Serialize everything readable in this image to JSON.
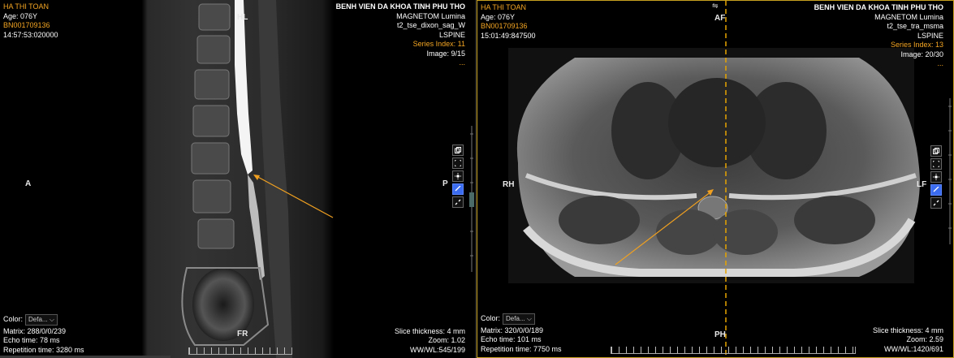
{
  "left_viewport": {
    "patient_name": "HA THI TOAN",
    "age": "Age: 076Y",
    "patient_id": "BN001709136",
    "time": "14:57:53:020000",
    "hospital": "BENH VIEN DA KHOA TINH PHU THO",
    "scanner": "MAGNETOM Lumina",
    "sequence": "t2_tse_dixon_sag_W",
    "body_part": "LSPINE",
    "series_index": "Series Index: 11",
    "image": "Image: 9/15",
    "more": "...",
    "orient_top": "HL",
    "orient_left": "A",
    "orient_right": "P",
    "orient_bottom": "FR",
    "color_label": "Color:",
    "color_value": "Defa...",
    "matrix": "Matrix: 288/0/0/239",
    "echo_time": "Echo time: 78 ms",
    "repetition_time": "Repetition time: 3280 ms",
    "slice_thickness": "Slice thickness: 4 mm",
    "zoom": "Zoom: 1.02",
    "window": "WW/WL:545/199"
  },
  "right_viewport": {
    "patient_name": "HA THI TOAN",
    "age": "Age: 076Y",
    "patient_id": "BN001709136",
    "time": "15:01:49:847500",
    "hospital": "BENH VIEN DA KHOA TINH PHU THO",
    "scanner": "MAGNETOM Lumina",
    "sequence": "t2_tse_tra_msma",
    "body_part": "LSPINE",
    "series_index": "Series Index: 13",
    "image": "Image: 20/30",
    "more": "...",
    "orient_top": "AF",
    "orient_left": "RH",
    "orient_right": "LF",
    "orient_bottom": "PH",
    "color_label": "Color:",
    "color_value": "Defa...",
    "matrix": "Matrix: 320/0/0/189",
    "echo_time": "Echo time: 101 ms",
    "repetition_time": "Repetition time: 7750 ms",
    "slice_thickness": "Slice thickness: 4 mm",
    "zoom": "Zoom: 2.59",
    "window": "WW/WL:1420/691"
  },
  "colors": {
    "accent_orange": "#f5a623",
    "tool_active": "#3b6cf0",
    "reference_line": "#e6a400"
  },
  "tools": [
    "copy-icon",
    "fit-icon",
    "brightness-icon",
    "link-icon",
    "unlink-icon"
  ]
}
